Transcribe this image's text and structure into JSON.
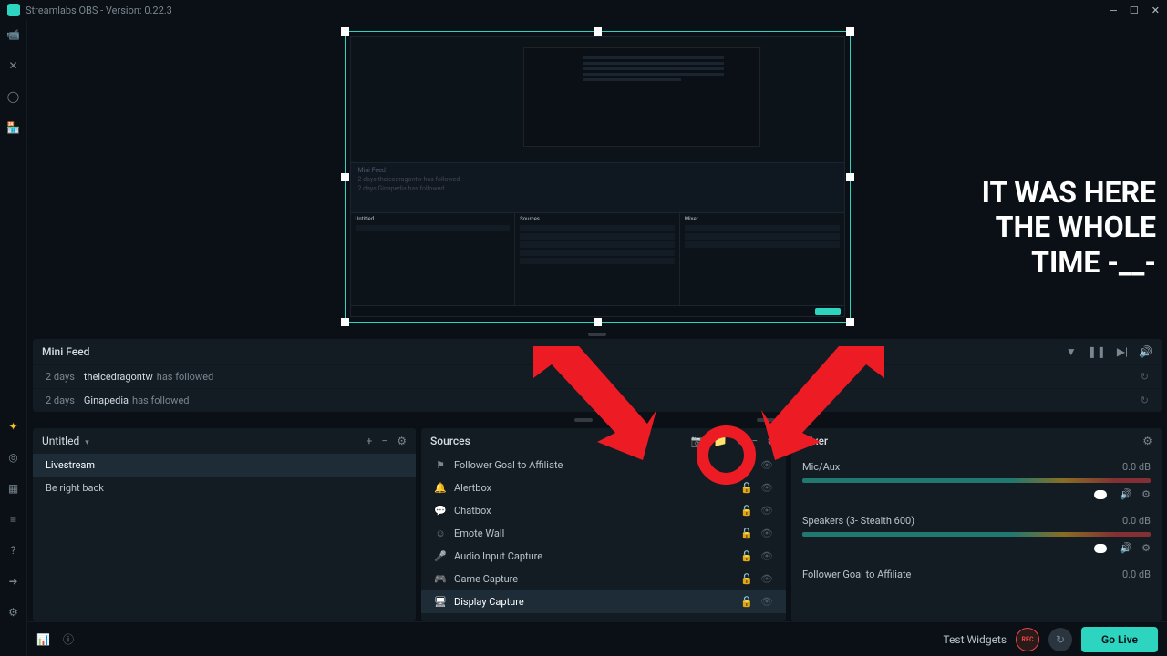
{
  "titlebar": {
    "title": "Streamlabs OBS - Version: 0.22.3"
  },
  "annotation": {
    "line1": "IT WAS HERE",
    "line2": "THE WHOLE",
    "line3": "TIME -__-"
  },
  "minifeed": {
    "title": "Mini Feed",
    "items": [
      {
        "time": "2 days",
        "user": "theicedragontw",
        "action": "has followed"
      },
      {
        "time": "2 days",
        "user": "Ginapedia",
        "action": "has followed"
      }
    ]
  },
  "scenes": {
    "collection": "Untitled",
    "items": [
      {
        "label": "Livestream",
        "selected": true
      },
      {
        "label": "Be right back",
        "selected": false
      }
    ]
  },
  "sources": {
    "title": "Sources",
    "items": [
      {
        "icon": "flag",
        "label": "Follower Goal to Affiliate"
      },
      {
        "icon": "bell",
        "label": "Alertbox"
      },
      {
        "icon": "chat",
        "label": "Chatbox"
      },
      {
        "icon": "smile",
        "label": "Emote Wall"
      },
      {
        "icon": "mic",
        "label": "Audio Input Capture"
      },
      {
        "icon": "gamepad",
        "label": "Game Capture"
      },
      {
        "icon": "monitor",
        "label": "Display Capture",
        "selected": true
      }
    ]
  },
  "mixer": {
    "title": "Mixer",
    "items": [
      {
        "name": "Mic/Aux",
        "db": "0.0 dB"
      },
      {
        "name": "Speakers (3- Stealth 600)",
        "db": "0.0 dB"
      },
      {
        "name": "Follower Goal to Affiliate",
        "db": "0.0 dB",
        "nobar": true
      }
    ]
  },
  "bottombar": {
    "test_widgets": "Test Widgets",
    "rec": "REC",
    "golive": "Go Live"
  },
  "icons": {
    "plus": "+",
    "minus": "−",
    "gear": "⚙",
    "filter": "⍞",
    "pause": "❚❚",
    "next": "▶|",
    "volume": "🔊",
    "refresh": "↻",
    "lock": "🔒",
    "eye": "👁",
    "folder": "📁",
    "camera": "📷"
  }
}
